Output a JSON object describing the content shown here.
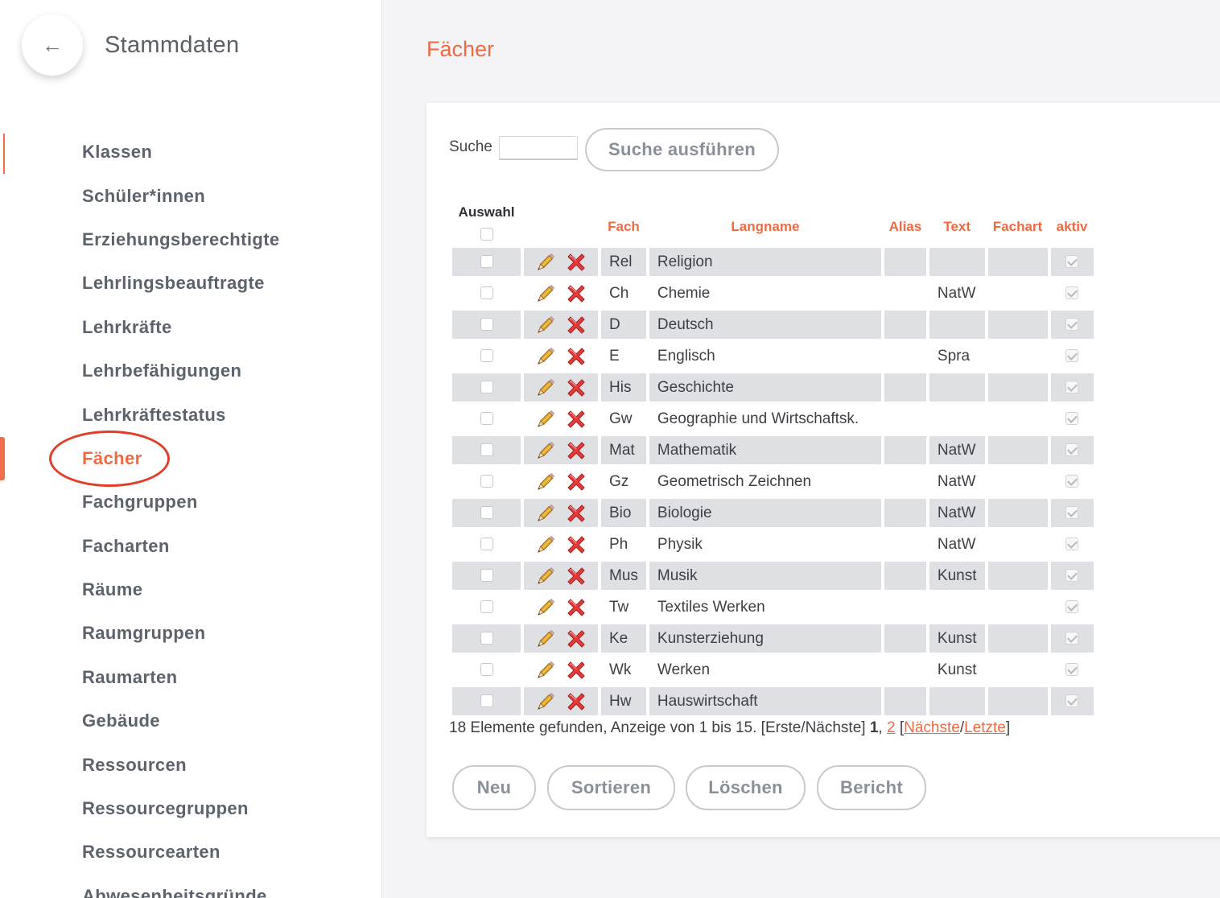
{
  "sidebar": {
    "back_icon": "arrow-left-icon",
    "back_glyph": "←",
    "title": "Stammdaten",
    "items": [
      {
        "label": "Klassen"
      },
      {
        "label": "Schüler*innen"
      },
      {
        "label": "Erziehungsberechtigte"
      },
      {
        "label": "Lehrlingsbeauftragte"
      },
      {
        "label": "Lehrkräfte"
      },
      {
        "label": "Lehrbefähigungen"
      },
      {
        "label": "Lehrkräftestatus"
      },
      {
        "label": "Fächer",
        "active": true
      },
      {
        "label": "Fachgruppen"
      },
      {
        "label": "Facharten"
      },
      {
        "label": "Räume"
      },
      {
        "label": "Raumgruppen"
      },
      {
        "label": "Raumarten"
      },
      {
        "label": "Gebäude"
      },
      {
        "label": "Ressourcen"
      },
      {
        "label": "Ressourcegruppen"
      },
      {
        "label": "Ressourcearten"
      },
      {
        "label": "Abwesenheitsgründe"
      }
    ],
    "accent_color": "#ee6a43",
    "highlight_color": "#e03e2a"
  },
  "page": {
    "title": "Fächer"
  },
  "search": {
    "label": "Suche",
    "value": "",
    "button_label": "Suche ausführen"
  },
  "table": {
    "headers": {
      "auswahl": "Auswahl",
      "fach": "Fach",
      "langname": "Langname",
      "alias": "Alias",
      "text": "Text",
      "fachart": "Fachart",
      "aktiv": "aktiv"
    },
    "edit_icon": "pencil-icon",
    "delete_icon": "red-x-icon",
    "rows": [
      {
        "fach": "Rel",
        "langname": "Religion",
        "alias": "",
        "text": "",
        "fachart": "",
        "aktiv": true
      },
      {
        "fach": "Ch",
        "langname": "Chemie",
        "alias": "",
        "text": "NatW",
        "fachart": "",
        "aktiv": true
      },
      {
        "fach": "D",
        "langname": "Deutsch",
        "alias": "",
        "text": "",
        "fachart": "",
        "aktiv": true
      },
      {
        "fach": "E",
        "langname": "Englisch",
        "alias": "",
        "text": "Spra",
        "fachart": "",
        "aktiv": true
      },
      {
        "fach": "His",
        "langname": "Geschichte",
        "alias": "",
        "text": "",
        "fachart": "",
        "aktiv": true
      },
      {
        "fach": "Gw",
        "langname": "Geographie und Wirtschaftsk.",
        "alias": "",
        "text": "",
        "fachart": "",
        "aktiv": true
      },
      {
        "fach": "Mat",
        "langname": "Mathematik",
        "alias": "",
        "text": "NatW",
        "fachart": "",
        "aktiv": true
      },
      {
        "fach": "Gz",
        "langname": "Geometrisch Zeichnen",
        "alias": "",
        "text": "NatW",
        "fachart": "",
        "aktiv": true
      },
      {
        "fach": "Bio",
        "langname": "Biologie",
        "alias": "",
        "text": "NatW",
        "fachart": "",
        "aktiv": true
      },
      {
        "fach": "Ph",
        "langname": "Physik",
        "alias": "",
        "text": "NatW",
        "fachart": "",
        "aktiv": true
      },
      {
        "fach": "Mus",
        "langname": "Musik",
        "alias": "",
        "text": "Kunst",
        "fachart": "",
        "aktiv": true
      },
      {
        "fach": "Tw",
        "langname": "Textiles Werken",
        "alias": "",
        "text": "",
        "fachart": "",
        "aktiv": true
      },
      {
        "fach": "Ke",
        "langname": "Kunsterziehung",
        "alias": "",
        "text": "Kunst",
        "fachart": "",
        "aktiv": true
      },
      {
        "fach": "Wk",
        "langname": "Werken",
        "alias": "",
        "text": "Kunst",
        "fachart": "",
        "aktiv": true
      },
      {
        "fach": "Hw",
        "langname": "Hauswirtschaft",
        "alias": "",
        "text": "",
        "fachart": "",
        "aktiv": true
      }
    ]
  },
  "pagination": {
    "summary": "18 Elemente gefunden, Anzeige von 1 bis 15. [Erste/Nächste]",
    "current_page": "1",
    "separator": ",",
    "next_page": "2",
    "open_bracket": "[",
    "next_label": "Nächste",
    "slash": "/",
    "last_label": "Letzte",
    "close_bracket": "]"
  },
  "actions": {
    "new_label": "Neu",
    "sort_label": "Sortieren",
    "delete_label": "Löschen",
    "report_label": "Bericht"
  }
}
